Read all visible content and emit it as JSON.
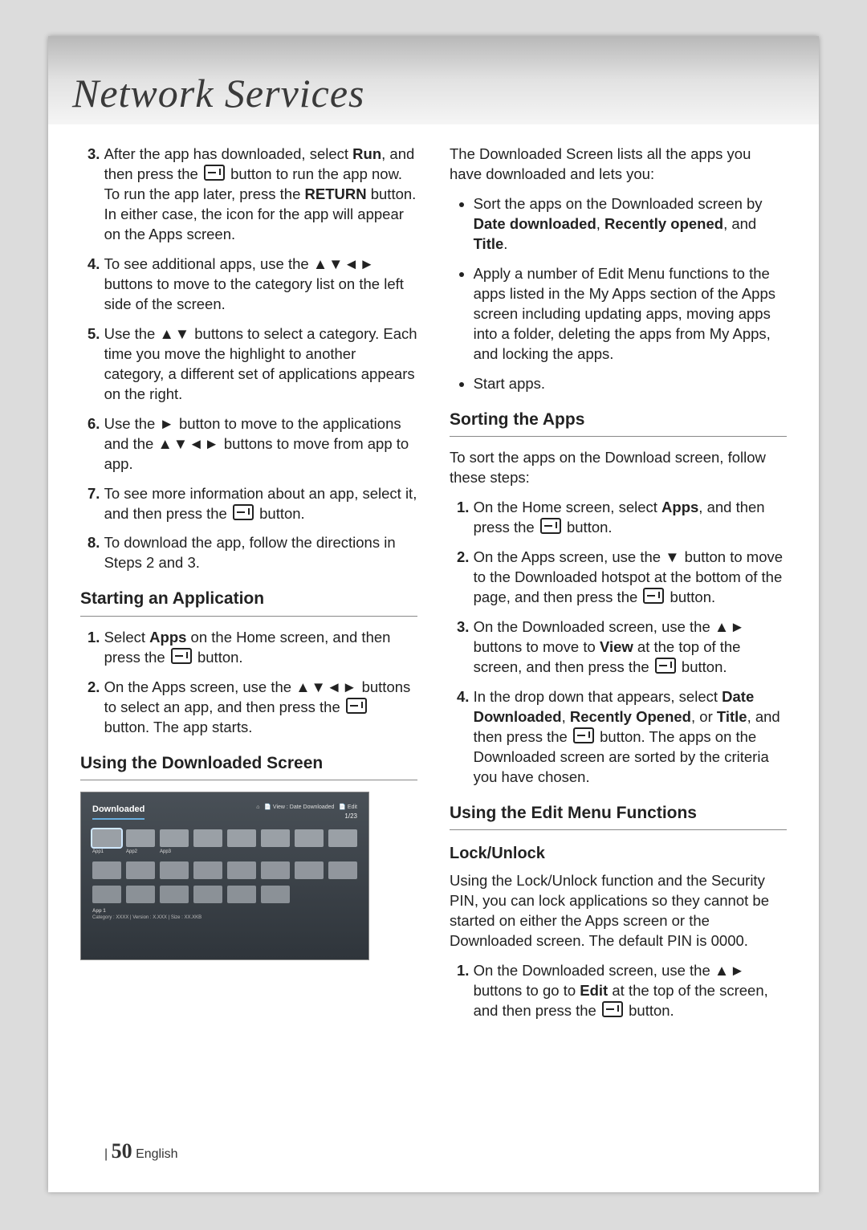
{
  "title": "Network Services",
  "left": {
    "steps_cont": [
      {
        "num": "3.",
        "parts": [
          "After the app has downloaded, select ",
          {
            "b": "Run"
          },
          ", and then press the ",
          {
            "icon": "enter"
          },
          " button to run the app now. To run the app later, press the ",
          {
            "b": "RETURN"
          },
          " button. In either case, the icon for the app will appear on the Apps screen."
        ]
      },
      {
        "num": "4.",
        "parts": [
          "To see additional apps, use the ",
          {
            "arr": "▲▼◄►"
          },
          " buttons to move to the category list on the left side of the screen."
        ]
      },
      {
        "num": "5.",
        "parts": [
          "Use the ",
          {
            "arr": "▲▼"
          },
          " buttons to select a category. Each time you move the highlight to another category, a different set of applications appears on the right."
        ]
      },
      {
        "num": "6.",
        "parts": [
          "Use the ",
          {
            "arr": "►"
          },
          " button to move to the applications and the ",
          {
            "arr": "▲▼◄►"
          },
          " buttons to move from app to app."
        ]
      },
      {
        "num": "7.",
        "parts": [
          "To see more information about an app, select it, and then press the ",
          {
            "icon": "enter"
          },
          " button."
        ]
      },
      {
        "num": "8.",
        "parts": [
          "To download the app, follow the directions in Steps 2 and 3."
        ]
      }
    ],
    "start_head": "Starting an Application",
    "start_steps": [
      {
        "num": "1.",
        "parts": [
          "Select ",
          {
            "b": "Apps"
          },
          " on the Home screen, and then press the ",
          {
            "icon": "enter"
          },
          " button."
        ]
      },
      {
        "num": "2.",
        "parts": [
          "On the Apps screen, use the ",
          {
            "arr": "▲▼◄►"
          },
          " buttons to select an app, and then press the ",
          {
            "icon": "enter"
          },
          " button. The app starts."
        ]
      }
    ],
    "downloaded_head": "Using the Downloaded Screen",
    "mock": {
      "title": "Downloaded",
      "top_right": "⌂   📄 View : Date Downloaded   📄 Edit",
      "page_indicator": "1/23",
      "labels": [
        "App1",
        "App2",
        "App3"
      ],
      "footer_title": "App 1",
      "footer_meta": "Category : XXXX  |  Version : X.XXX  |  Size : XX.XKB"
    }
  },
  "right": {
    "intro": "The Downloaded Screen lists all the apps you have downloaded and lets you:",
    "intro_bullets": [
      {
        "parts": [
          "Sort the apps on the Downloaded screen by ",
          {
            "b": "Date downloaded"
          },
          ", ",
          {
            "b": "Recently opened"
          },
          ", and ",
          {
            "b": "Title"
          },
          "."
        ]
      },
      {
        "parts": [
          "Apply a number of Edit Menu functions to the apps listed in the My Apps section of the Apps screen including updating apps, moving apps into a folder, deleting the apps from My Apps, and locking the apps."
        ]
      },
      {
        "parts": [
          "Start apps."
        ]
      }
    ],
    "sorting_head": "Sorting the Apps",
    "sorting_intro": "To sort the apps on the Download screen, follow these steps:",
    "sorting_steps": [
      {
        "num": "1.",
        "parts": [
          "On the Home screen, select ",
          {
            "b": "Apps"
          },
          ", and then press the ",
          {
            "icon": "enter"
          },
          " button."
        ]
      },
      {
        "num": "2.",
        "parts": [
          "On the Apps screen, use the ",
          {
            "arr": "▼"
          },
          " button to move to the Downloaded hotspot at the bottom of the page, and then press the ",
          {
            "icon": "enter"
          },
          " button."
        ]
      },
      {
        "num": "3.",
        "parts": [
          "On the Downloaded screen, use the ",
          {
            "arr": "▲►"
          },
          " buttons to move to ",
          {
            "b": "View"
          },
          " at the top of the screen, and then press the ",
          {
            "icon": "enter"
          },
          " button."
        ]
      },
      {
        "num": "4.",
        "parts": [
          "In the drop down that appears, select ",
          {
            "b": "Date Downloaded"
          },
          ", ",
          {
            "b": "Recently Opened"
          },
          ", or ",
          {
            "b": "Title"
          },
          ", and then press the ",
          {
            "icon": "enter"
          },
          " button. The apps on the Downloaded screen are sorted by the criteria you have chosen."
        ]
      }
    ],
    "edit_head": "Using the Edit Menu Functions",
    "lock_head": "Lock/Unlock",
    "lock_para": "Using the Lock/Unlock function and the Security PIN, you can lock applications so they cannot be started on either the Apps screen or the Downloaded screen. The default PIN is 0000.",
    "lock_steps": [
      {
        "num": "1.",
        "parts": [
          "On the Downloaded screen, use the ",
          {
            "arr": "▲►"
          },
          " buttons to go to ",
          {
            "b": "Edit"
          },
          " at the top of the screen, and then press the ",
          {
            "icon": "enter"
          },
          " button."
        ]
      }
    ]
  },
  "footer": {
    "page": "50",
    "lang": "English",
    "bar": "|"
  }
}
